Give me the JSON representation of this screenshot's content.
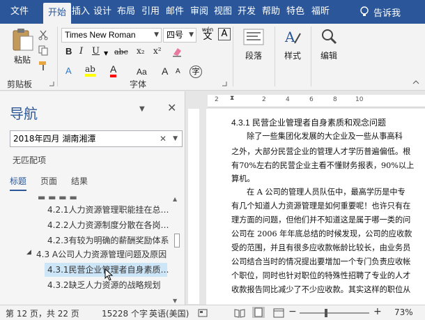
{
  "tabs": [
    "文件",
    "开始",
    "插入",
    "设计",
    "布局",
    "引用",
    "邮件",
    "审阅",
    "视图",
    "开发",
    "帮助",
    "特色",
    "福昕"
  ],
  "tell_me": "告诉我",
  "ribbon": {
    "paste_label": "粘贴",
    "clipboard_label": "剪贴板",
    "font_name": "Times New Roman",
    "font_size": "四号",
    "wen_label": "wén",
    "font_group_label": "字体",
    "paragraph_label": "段落",
    "style_label": "样式",
    "edit_label": "编辑",
    "bold": "B",
    "italic": "I",
    "underline": "U",
    "strike": "abc",
    "subscript": "x₂",
    "superscript": "x²",
    "highlight": "ab",
    "font_color": "A",
    "aa": "Aa",
    "grow": "A",
    "shrink": "A",
    "circle_a": "A",
    "circle_zi": "字",
    "boxed_a": "A"
  },
  "nav": {
    "title": "导航",
    "search_value": "2018年四月  湖南湘潭",
    "no_match": "无匹配项",
    "tabs": [
      "标题",
      "页面",
      "结果"
    ],
    "items": [
      {
        "text": "4.2.1人力资源管理职能挂在总…"
      },
      {
        "text": "4.2.2人力资源制度分散在各岗…"
      },
      {
        "text": "4.2.3有较为明确的薪酬奖励体系"
      },
      {
        "text": "4.3  A公司人力资源管理问题及原因"
      },
      {
        "text": "4.3.1民营企业管理者自身素质…"
      },
      {
        "text": "4.3.2缺乏人力资源的战略规划"
      }
    ]
  },
  "document": {
    "heading": "4.3.1 民营企业管理者自身素质和观念问题",
    "lines": [
      "除了一些集团化发展的大企业及一些从事高科",
      "之外，大部分民营企业的管理人才学历普遍偏低。根",
      "有70%左右的民营企业主看不懂财务报表，90%以上",
      "算机。",
      "在 A 公司的管理人员队伍中，最高学历是中专",
      "有几个知道人力资源管理是如何重要呢！也许只有在",
      "理方面的问题，但他们并不知道这是属于哪一类的问",
      "公司在 2006 年年底总结的时候发现，公司的应收款",
      "受的范围，并且有很多应收款帐龄比较长，由业务员",
      "公司结合当时的情况提出要增加一个专门负责应收帐",
      "个职位，同时也针对职位的特殊性招聘了专业的人才",
      "收款报告同比减少了不少应收款。其实这样的职位从"
    ],
    "ruler_numbers": [
      "2",
      "2",
      "4",
      "6",
      "8",
      "10"
    ]
  },
  "status": {
    "page": "第 12 页，共 22 页",
    "words": "15228 个字",
    "lang": "英语(美国)",
    "zoom": "73%",
    "minus": "−",
    "plus": "+"
  },
  "colors": {
    "accent": "#2b579a",
    "highlight_yellow": "#ffff00",
    "font_red": "#ff0000",
    "selection": "#cde6f7"
  }
}
